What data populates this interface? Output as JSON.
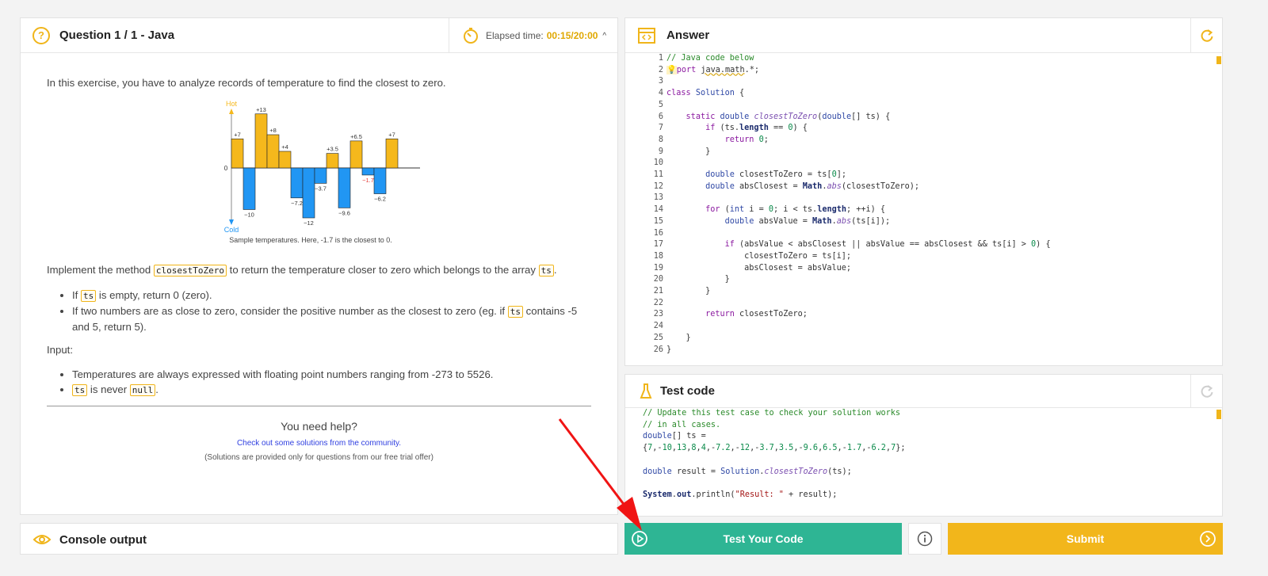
{
  "question": {
    "title": "Question 1 / 1 - Java",
    "elapsed_label": "Elapsed time:",
    "elapsed_value": "00:15/20:00",
    "intro": "In this exercise, you have to analyze records of temperature to find the closest to zero.",
    "implement_pre": "Implement the method",
    "implement_code": "closestToZero",
    "implement_post": "to return the temperature closer to zero which belongs to the array",
    "implement_code2": "ts",
    "implement_end": ".",
    "bullet1_pre": "If",
    "bullet1_code": "ts",
    "bullet1_post": "is empty, return 0 (zero).",
    "bullet2_pre": "If two numbers are as close to zero, consider the positive number as the closest to zero (eg. if",
    "bullet2_code": "ts",
    "bullet2_post": "contains -5 and 5, return 5).",
    "input_label": "Input:",
    "input1": "Temperatures are always expressed with floating point numbers ranging from -273 to 5526.",
    "input2_code": "ts",
    "input2_mid": "is never",
    "input2_code2": "null",
    "input2_end": ".",
    "help_title": "You need help?",
    "help_link": "Check out some solutions from the community.",
    "help_note": "(Solutions are provided only for questions from our free trial offer)"
  },
  "chart_data": {
    "type": "bar",
    "top_label": "Hot",
    "bottom_label": "Cold",
    "zero_label": "0",
    "values": [
      7,
      -10,
      13,
      8,
      4,
      -7.2,
      -12,
      -3.7,
      3.5,
      -9.6,
      6.5,
      -1.7,
      -6.2,
      7
    ],
    "labels": [
      "+7",
      "−10",
      "+13",
      "+8",
      "+4",
      "−7.2",
      "−12",
      "−3.7",
      "+3.5",
      "−9.6",
      "+6.5",
      "−1.7",
      "−6.2",
      "+7"
    ],
    "highlight_index": 11,
    "caption": "Sample temperatures. Here, -1.7 is the closest to 0.",
    "colors": {
      "positive": "#f5b81c",
      "negative": "#2196f3",
      "highlight": "#e53935"
    }
  },
  "answer": {
    "title": "Answer",
    "line_numbers": [
      "1",
      "2",
      "3",
      "4",
      "5",
      "6",
      "7",
      "8",
      "9",
      "10",
      "11",
      "12",
      "13",
      "14",
      "15",
      "16",
      "17",
      "18",
      "19",
      "20",
      "21",
      "22",
      "23",
      "24",
      "25",
      "26"
    ]
  },
  "test": {
    "title": "Test code"
  },
  "console": {
    "title": "Console output"
  },
  "actions": {
    "test_label": "Test Your Code",
    "submit_label": "Submit"
  },
  "colors": {
    "accent": "#f0b51a",
    "test_button": "#2eb594",
    "submit_button": "#f2b61b"
  }
}
